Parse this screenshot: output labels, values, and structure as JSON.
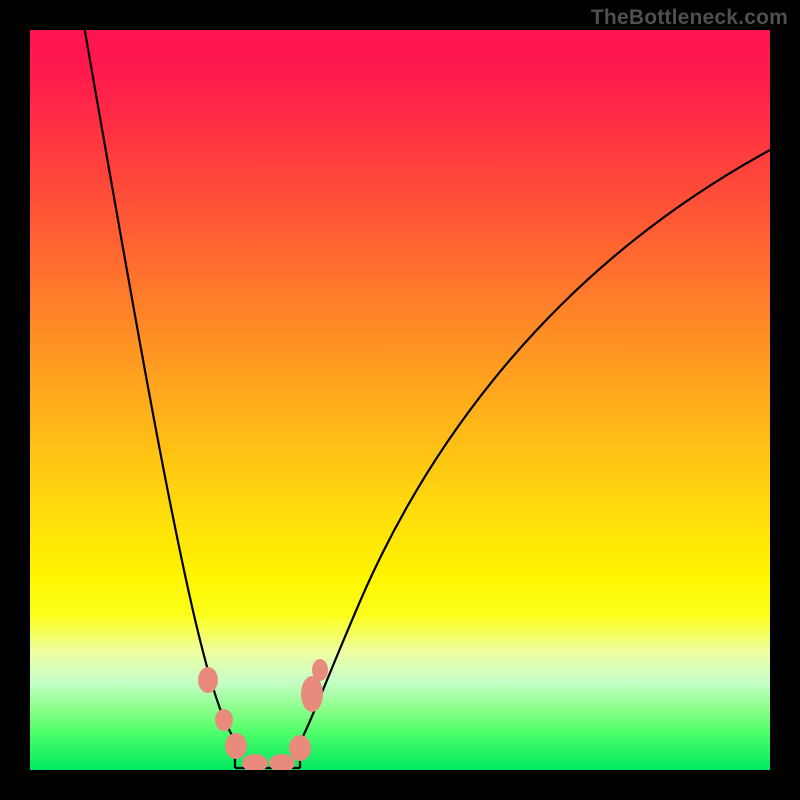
{
  "watermark": {
    "text": "TheBottleneck.com"
  },
  "chart_data": {
    "type": "line",
    "title": "",
    "xlabel": "",
    "ylabel": "",
    "xlim": [
      0,
      100
    ],
    "ylim": [
      0,
      100
    ],
    "series": [
      {
        "name": "bottleneck-curve",
        "x": [
          7,
          12,
          18,
          23,
          27,
          28,
          30,
          32,
          35,
          36,
          40,
          48,
          60,
          75,
          90,
          100
        ],
        "y": [
          100,
          74,
          48,
          27,
          10,
          3,
          0,
          0,
          0,
          3,
          15,
          36,
          58,
          74,
          82,
          86
        ]
      }
    ],
    "markers": {
      "name": "valley-points",
      "color": "#e88b7d",
      "x": [
        24.0,
        26.2,
        27.8,
        30.4,
        34.0,
        36.5,
        38.1,
        39.2
      ],
      "y": [
        12.2,
        6.8,
        3.2,
        0.9,
        0.9,
        3.0,
        10.3,
        13.5
      ]
    },
    "background_gradient": {
      "direction": "vertical",
      "stops": [
        {
          "pos": 0.0,
          "color": "#ff1450"
        },
        {
          "pos": 0.27,
          "color": "#ff5d33"
        },
        {
          "pos": 0.52,
          "color": "#ffb21a"
        },
        {
          "pos": 0.74,
          "color": "#fff500"
        },
        {
          "pos": 0.88,
          "color": "#c8ffc8"
        },
        {
          "pos": 1.0,
          "color": "#00e860"
        }
      ]
    }
  }
}
